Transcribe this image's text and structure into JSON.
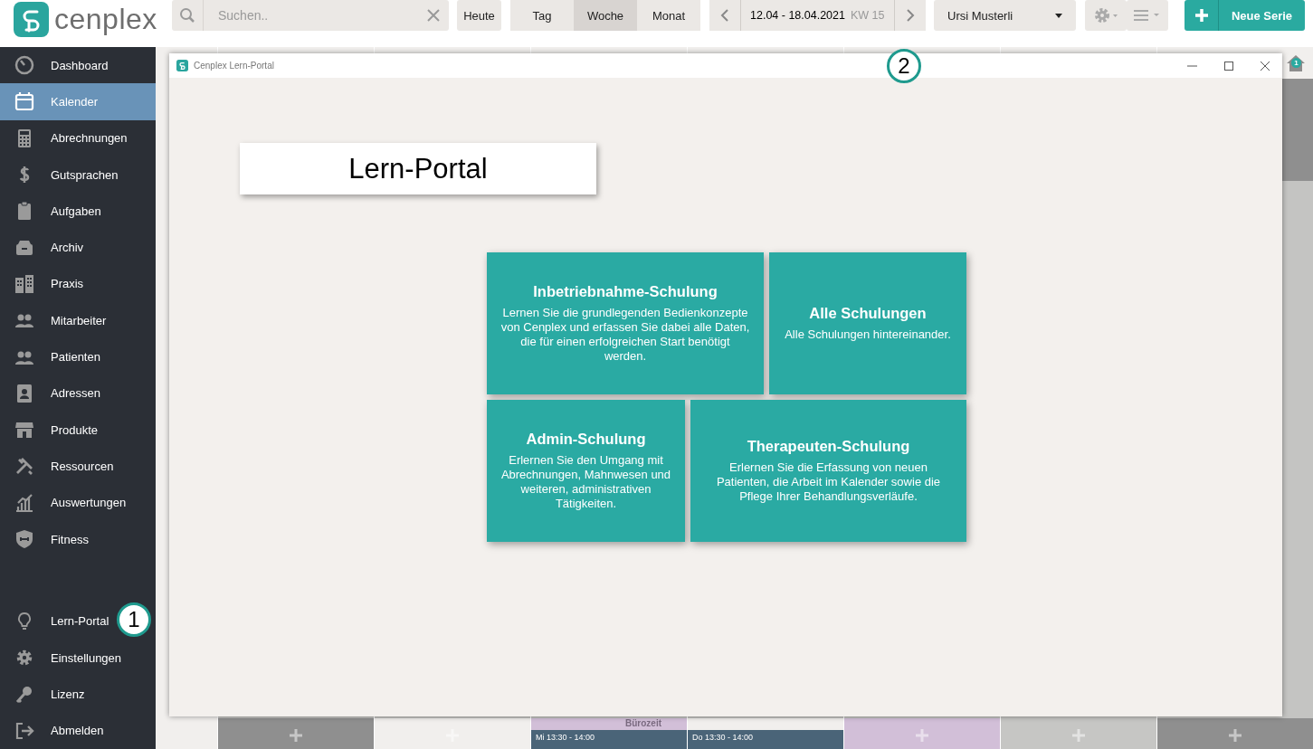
{
  "header": {
    "logo": "cenplex",
    "search": {
      "placeholder": "Suchen.."
    },
    "today": "Heute",
    "views": [
      {
        "label": "Tag",
        "selected": false
      },
      {
        "label": "Woche",
        "selected": true
      },
      {
        "label": "Monat",
        "selected": false
      }
    ],
    "date_range": "12.04 - 18.04.2021",
    "week": "KW 15",
    "user": "Ursi Musterli",
    "new_button": "Neue Serie"
  },
  "sidebar": {
    "items": [
      {
        "label": "Dashboard",
        "selected": false
      },
      {
        "label": "Kalender",
        "selected": true
      },
      {
        "label": "Abrechnungen",
        "selected": false
      },
      {
        "label": "Gutsprachen",
        "selected": false
      },
      {
        "label": "Aufgaben",
        "selected": false
      },
      {
        "label": "Archiv",
        "selected": false
      },
      {
        "label": "Praxis",
        "selected": false
      },
      {
        "label": "Mitarbeiter",
        "selected": false
      },
      {
        "label": "Patienten",
        "selected": false
      },
      {
        "label": "Adressen",
        "selected": false
      },
      {
        "label": "Produkte",
        "selected": false
      },
      {
        "label": "Ressourcen",
        "selected": false
      },
      {
        "label": "Auswertungen",
        "selected": false
      },
      {
        "label": "Fitness",
        "selected": false
      }
    ],
    "bottom_items": [
      {
        "label": "Lern-Portal",
        "selected": false
      },
      {
        "label": "Einstellungen",
        "selected": false
      },
      {
        "label": "Lizenz",
        "selected": false
      },
      {
        "label": "Abmelden",
        "selected": false
      }
    ]
  },
  "calendar": {
    "notification_badge": "1",
    "columns": [
      {
        "color": "#8f8f8f"
      },
      {
        "color": "#f1efed"
      },
      {
        "color": "#d2bfd8",
        "label": "Bürozeit",
        "events": [
          "Mi 13:30 - 14:00"
        ]
      },
      {
        "color": "#f1efed",
        "events": [
          "Do 13:30 - 14:00"
        ]
      },
      {
        "color": "#d2bfd8"
      },
      {
        "color": "#c6c6c4"
      },
      {
        "color": "#8f8f8f"
      }
    ]
  },
  "window": {
    "title": "Cenplex Lern-Portal",
    "heading": "Lern-Portal",
    "tiles": [
      {
        "title": "Inbetriebnahme-Schulung",
        "text": "Lernen Sie die grundlegenden Bedienkonzepte von Cenplex und erfassen Sie dabei alle Daten, die für einen erfolgreichen Start benötigt werden."
      },
      {
        "title": "Alle Schulungen",
        "text": "Alle Schulungen hintereinander."
      },
      {
        "title": "Admin-Schulung",
        "text": "Erlernen Sie den Umgang mit Abrechnungen, Mahnwesen und weiteren, administrativen Tätigkeiten."
      },
      {
        "title": "Therapeuten-Schulung",
        "text": "Erlernen Sie die Erfassung von neuen Patienten, die Arbeit im Kalender sowie die Pflege Ihrer Behandlungsverläufe."
      }
    ]
  },
  "callouts": [
    "1",
    "2"
  ]
}
